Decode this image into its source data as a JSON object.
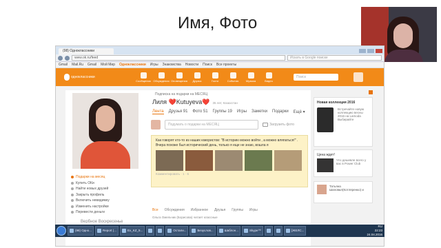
{
  "slide": {
    "title": "Имя, Фото"
  },
  "browser": {
    "tab_title": "(98) Одноклассники",
    "url": "www.ok.ru/feed",
    "search_placeholder": "Искать в Google поиске",
    "bookmarks": [
      "Gmail",
      "Mail.Ru",
      "Gmail",
      "Мой Мир",
      "Одноклассники",
      "Игры",
      "Знакомства",
      "Новости",
      "Поиск",
      "Все проекты"
    ]
  },
  "ok": {
    "logo_text": "одноклассники",
    "toolbar": [
      "Сообщения",
      "Обсуждения",
      "Оповещения",
      "Друзья",
      "Гости",
      "События",
      "Музыка",
      "Видео"
    ],
    "search_placeholder": "Поиск"
  },
  "profile": {
    "top_note": "Подписка на подарки на МЕСЯЦ",
    "name": "Лиля ❤️Kutuyeva❤️",
    "info": "35 лет, Казахстан",
    "tabs": [
      "Лента",
      "Друзья 91",
      "Фото 51",
      "Группы 19",
      "Игры",
      "Заметки",
      "Подарки",
      "Ещё ▾"
    ],
    "post_placeholder": "Подумать о подарки на МЕСЯЦ",
    "upload_photo": "Загрузить фото",
    "left_links": [
      "Подарки на месяц",
      "Купить ОКи",
      "Найти новых друзей",
      "Закрыть профиль",
      "Включить невидимку",
      "Изменить настройки",
      "Перевести деньги"
    ],
    "weekend_text": "Вербное Воскресенье",
    "status_text": "Как говорят кто-то из наших юмористов: \"В историю можно войти , а можно вляпаться!\" . Вчера похоже был исторический день, только я еще не знаю, вошла я",
    "status_date": "Комментировать · 1 · 6",
    "feed_tabs": [
      "Все",
      "Обсуждения",
      "Избранное",
      "Друзья",
      "Группы",
      "Игры"
    ],
    "feed_line": "Ольга Омельчик (Борисова) читает классные"
  },
  "right": {
    "ad1_title": "Новая коллекция 2016",
    "ad1_text": "Встречайте новую коллекцию весны 2016 на Lamoda Выбирайте",
    "ad2_title": "Цена ждет!",
    "ad2_text": "Что дешевле всего у вас в Power Club",
    "friend_text": "Татьяна Шаповал(Котляренко) и"
  },
  "taskbar": {
    "items": [
      "(98) Одно...",
      "Report (...",
      "Ex_KZ_5...",
      "",
      "",
      "Остали...",
      "Безуслов...",
      "Шаблон...",
      "Skype™",
      "",
      "",
      "[ЖЕЛС..."
    ],
    "lang": "RU",
    "time": "22:23",
    "date": "24.04.2016"
  }
}
